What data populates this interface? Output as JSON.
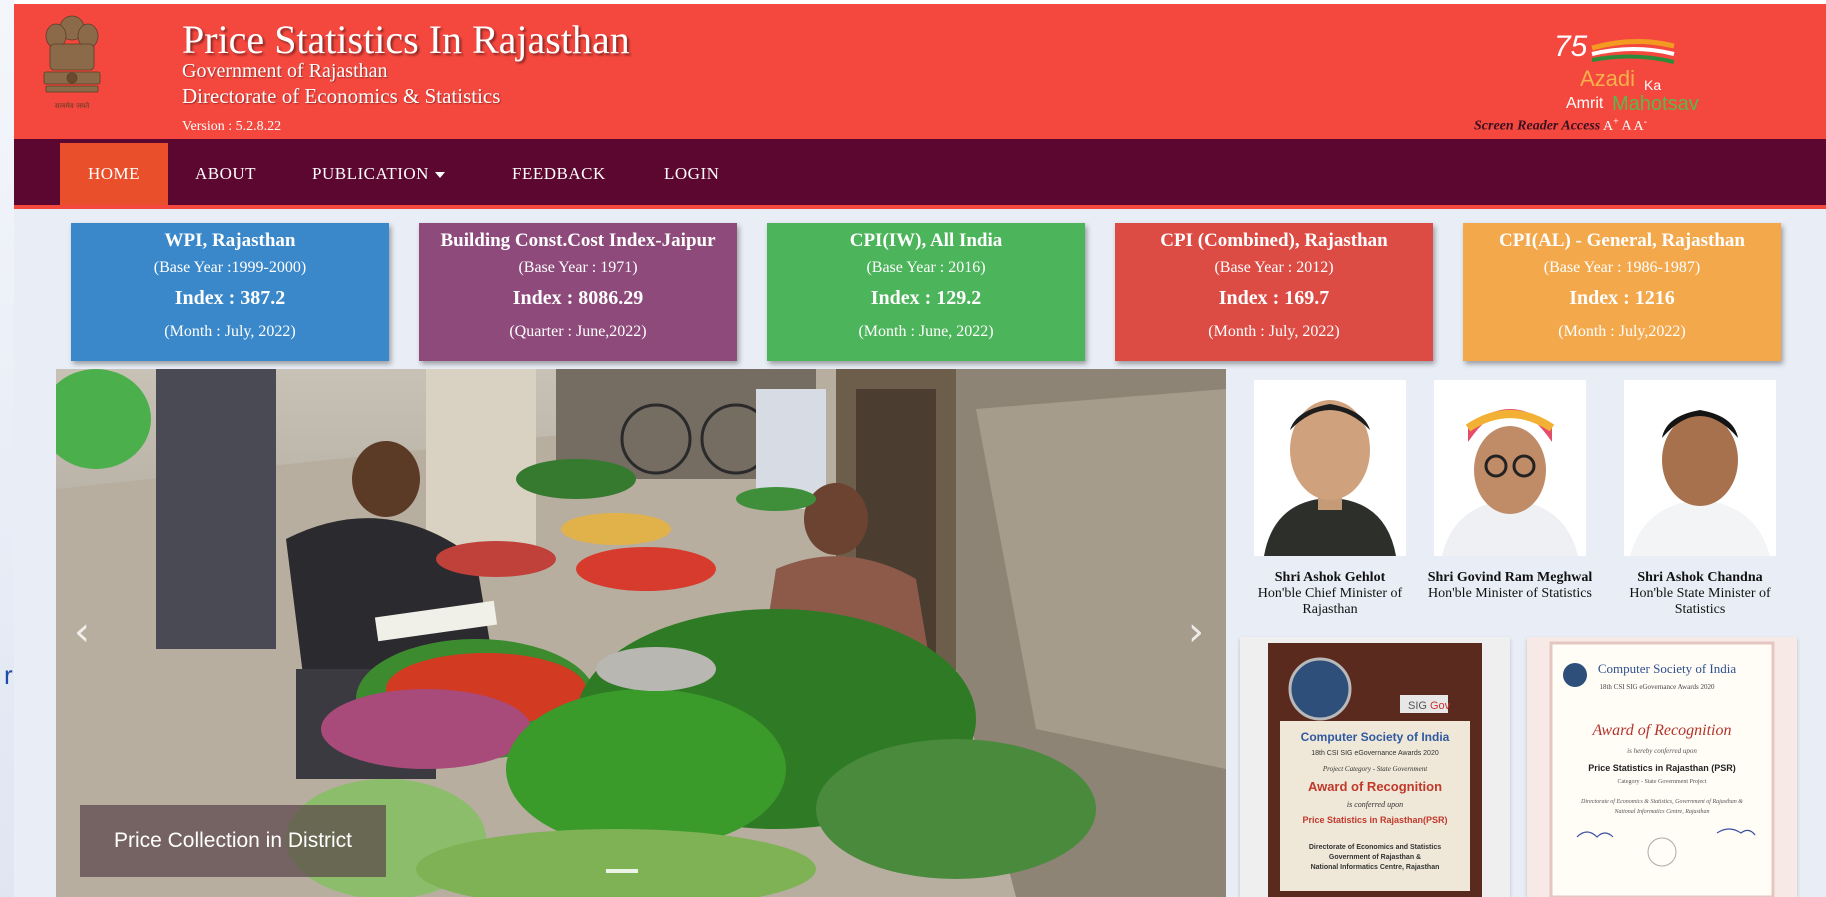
{
  "background": {
    "letter": "r"
  },
  "header": {
    "title": "Price Statistics In Rajasthan",
    "gov": "Government of Rajasthan",
    "directorate": "Directorate of Economics & Statistics",
    "version": "Version : 5.2.8.22",
    "emblem_caption": "सत्यमेव जयते",
    "amrit": {
      "num": "75",
      "line1": "Azadi",
      "ka": "Ka",
      "amrit": "Amrit",
      "mahotsav": "Mahotsav"
    },
    "screen_reader": "Screen Reader Access",
    "font_large": "A",
    "font_large_sup": "+",
    "font_normal": "A",
    "font_small": "A",
    "font_small_sup": "-"
  },
  "nav": {
    "home": "HOME",
    "about": "ABOUT",
    "publication": "PUBLICATION",
    "feedback": "FEEDBACK",
    "login": "LOGIN"
  },
  "cards": [
    {
      "title": "WPI, Rajasthan",
      "base": "(Base Year :1999-2000)",
      "index": "Index : 387.2",
      "period": "(Month : July, 2022)",
      "color": "#3a88c9"
    },
    {
      "title": "Building Const.Cost Index-Jaipur",
      "base": "(Base Year : 1971)",
      "index": "Index : 8086.29",
      "period": "(Quarter : June,2022)",
      "color": "#8e4a7a"
    },
    {
      "title": "CPI(IW), All India",
      "base": "(Base Year : 2016)",
      "index": "Index : 129.2",
      "period": "(Month : June, 2022)",
      "color": "#4cb45a"
    },
    {
      "title": "CPI (Combined), Rajasthan",
      "base": "(Base Year : 2012)",
      "index": "Index : 169.7",
      "period": "(Month : July, 2022)",
      "color": "#dc4b44"
    },
    {
      "title": "CPI(AL) - General, Rajasthan",
      "base": "(Base Year : 1986-1987)",
      "index": "Index : 1216",
      "period": "(Month : July,2022)",
      "color": "#f3a84c"
    }
  ],
  "slider": {
    "caption": "Price Collection in District",
    "prev": "‹",
    "next": "›"
  },
  "leaders": [
    {
      "name": "Shri Ashok Gehlot",
      "role": "Hon'ble Chief Minister of Rajasthan"
    },
    {
      "name": "Shri Govind Ram Meghwal",
      "role": "Hon'ble Minister of Statistics"
    },
    {
      "name": "Shri Ashok Chandna",
      "role": "Hon'ble State Minister of Statistics"
    }
  ],
  "awards": {
    "left": {
      "sig": "SIG",
      "gov": "Gov",
      "org": "Computer Society of India",
      "year": "18th CSI SIG eGovernance Awards 2020",
      "category": "Project Category - State Government",
      "title": "Award of Recognition",
      "conferred": "is conferred upon",
      "project": "Price Statistics in Rajasthan(PSR)",
      "to1": "Directorate of Economics and Statistics",
      "to2": "Government of Rajasthan &",
      "to3": "National Informatics Centre, Rajasthan"
    },
    "right": {
      "org": "Computer Society of India",
      "year": "18th CSI SIG eGovernance Awards 2020",
      "title": "Award of Recognition",
      "conferred": "is hereby conferred upon",
      "project": "Price Statistics in Rajasthan (PSR)",
      "category": "Category - State Government Project",
      "to1": "Directorate of Economics & Statistics, Government of Rajasthan &",
      "to2": "National Informatics Centre, Rajasthan"
    }
  }
}
